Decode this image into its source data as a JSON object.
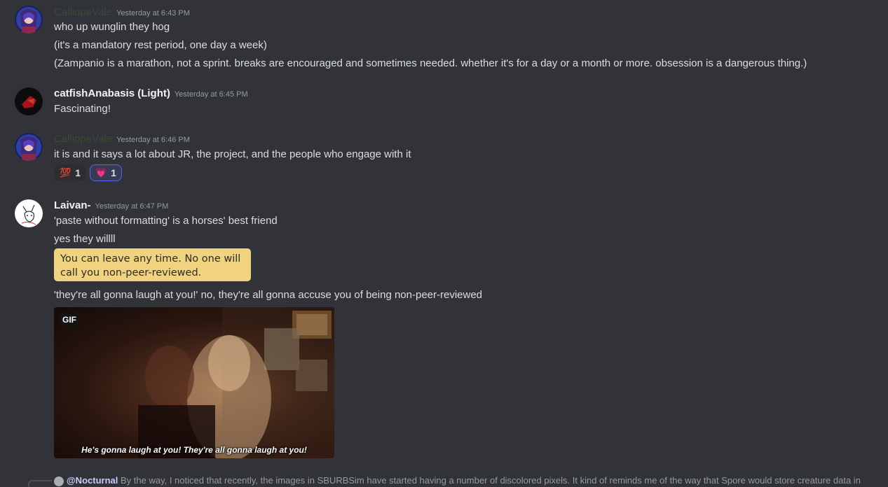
{
  "messages": [
    {
      "author": "CalliopeVale",
      "timestamp": "Yesterday at 6:43 PM",
      "lines": [
        "who up wunglin they hog",
        "(it's a mandatory rest period, one day a week)",
        "(Zampanio is a marathon, not a sprint. breaks are encouraged and sometimes needed. whether it's for a day or a month or more. obsession is a dangerous thing.)"
      ]
    },
    {
      "author": "catfishAnabasis (Light)",
      "timestamp": "Yesterday at 6:45 PM",
      "lines": [
        "Fascinating!"
      ]
    },
    {
      "author": "CalliopeVale",
      "timestamp": "Yesterday at 6:46 PM",
      "lines": [
        "it is and it says a lot about JR, the project, and the people who engage with it"
      ],
      "reactions": [
        {
          "emoji": "💯",
          "count": "1"
        },
        {
          "emoji": "💗",
          "count": "1"
        }
      ]
    },
    {
      "author": "Laivan-",
      "timestamp": "Yesterday at 6:47 PM",
      "lines": [
        "'paste without formatting' is a horses' best friend",
        "yes they willll",
        "'they're all gonna laugh at you!' no, they're all gonna accuse you of being non-peer-reviewed"
      ],
      "quote_image": {
        "line1": "You can leave any time. No one will",
        "line2": "call you non-peer-reviewed."
      },
      "gif": {
        "badge": "GIF",
        "caption": "He's gonna laugh at you! They're all gonna laugh at you!"
      }
    }
  ],
  "reply_preview": {
    "mention": "@Nocturnal",
    "text": "By the way, I noticed that recently, the images in SBURBSim have started having a number of discolored pixels. It kind of reminds me of the way that Spore would store creature data in"
  },
  "colors": {
    "background": "#313338",
    "text": "#dbdee1",
    "timestamp": "#949ba4",
    "reaction_highlight": "#5865f2"
  }
}
